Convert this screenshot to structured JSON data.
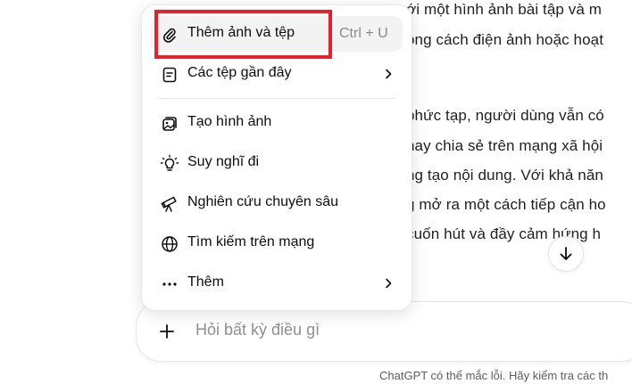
{
  "article": {
    "lines": [
      "ới một hình ảnh bài tập và m",
      "ong cách điện ảnh hoặc hoạt",
      "",
      "phức tạp, người dùng vẫn có",
      "hay chia sẻ trên mạng xã hội",
      "ng tạo nội dung. Với khả năn",
      "g mở ra một cách tiếp cận ho",
      "cuốn hút và đầy cảm hứng h"
    ]
  },
  "menu": {
    "items": [
      {
        "label": "Thêm ảnh và tệp",
        "shortcut": "Ctrl + U",
        "icon": "paperclip-icon"
      },
      {
        "label": "Các tệp gần đây",
        "icon": "file-icon",
        "submenu": true
      },
      {
        "label": "Tạo hình ảnh",
        "icon": "image-icon"
      },
      {
        "label": "Suy nghĩ đi",
        "icon": "lightbulb-icon"
      },
      {
        "label": "Nghiên cứu chuyên sâu",
        "icon": "telescope-icon"
      },
      {
        "label": "Tìm kiếm trên mạng",
        "icon": "globe-icon"
      },
      {
        "label": "Thêm",
        "icon": "more-dots-icon",
        "submenu": true
      }
    ]
  },
  "composer": {
    "placeholder": "Hỏi bất kỳ điều gì"
  },
  "footer": {
    "disclaimer": "ChatGPT có thể mắc lỗi. Hãy kiểm tra các th"
  },
  "colors": {
    "highlight": "#e8202a",
    "hover_bg": "#f3f3f3"
  }
}
